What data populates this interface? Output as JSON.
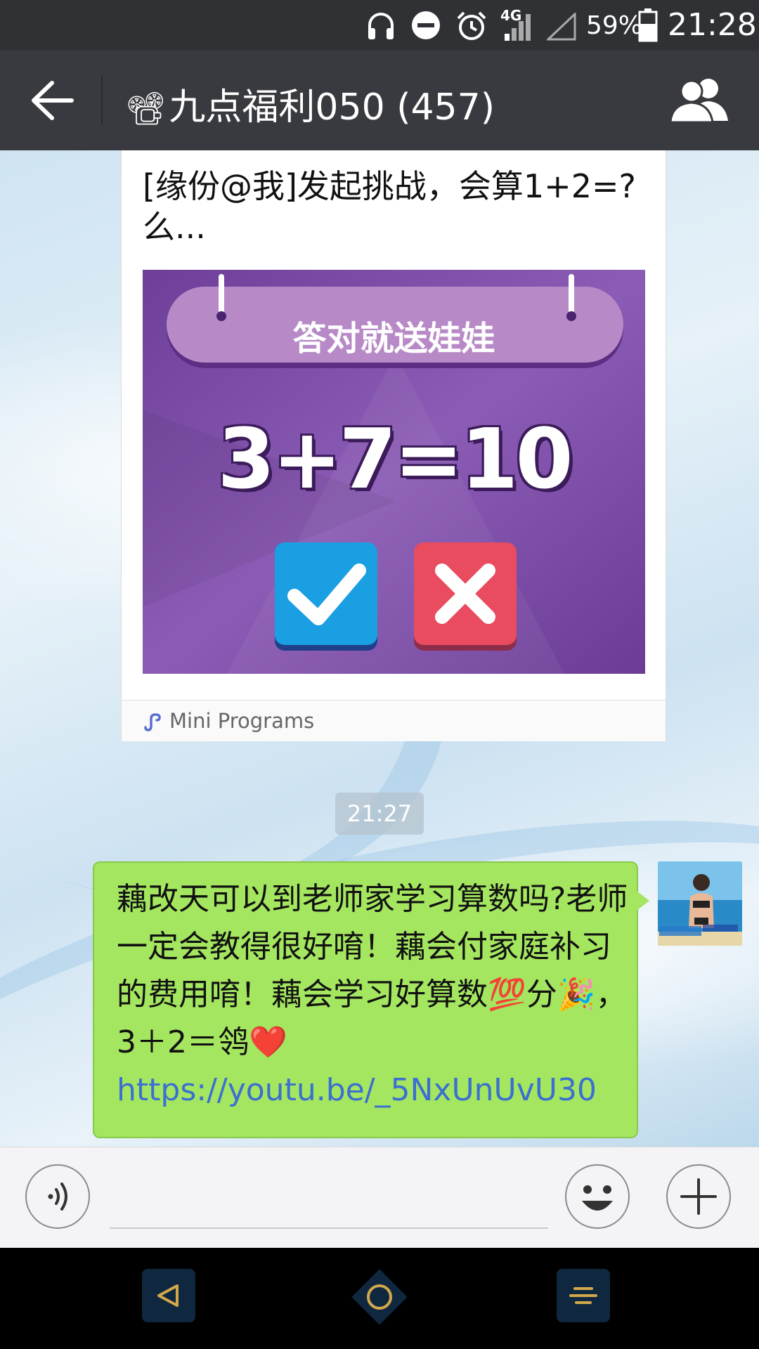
{
  "status_bar": {
    "network": "4G",
    "battery": "59%",
    "time": "21:28",
    "icons": [
      "headphones-icon",
      "dnd-icon",
      "alarm-icon",
      "signal-icon",
      "signal-empty-icon",
      "battery-icon"
    ]
  },
  "header": {
    "title_emoji": "📽",
    "title": "九点福利050 (457)",
    "back_icon": "back-arrow-icon",
    "members_icon": "group-members-icon"
  },
  "chat": {
    "mini_program": {
      "title": "[缘份@我]发起挑战，会算1+2=?么...",
      "banner": "答对就送娃娃",
      "equation": "3+7=10",
      "footer_label": "Mini Programs",
      "footer_icon": "mini-programs-icon"
    },
    "timestamp": "21:27",
    "my_message": {
      "text": "藕改天可以到老师家学习算数吗?老师一定会教得很好唷！藕会付家庭补习的费用唷！藕会学习好算数💯分🎉，3＋2＝鸰❤️",
      "link": "https://youtu.be/_5NxUnUvU30"
    }
  },
  "input_bar": {
    "voice_icon": "voice-icon",
    "emoji_icon": "emoji-icon",
    "plus_icon": "plus-icon",
    "placeholder": ""
  },
  "nav_bar": {
    "icons": [
      "nav-back-icon",
      "nav-home-icon",
      "nav-menu-icon"
    ]
  },
  "colors": {
    "header_bg": "#393a3f",
    "status_bg": "#2f3134",
    "my_bubble": "#a4e65f",
    "link": "#3b6fd1"
  }
}
